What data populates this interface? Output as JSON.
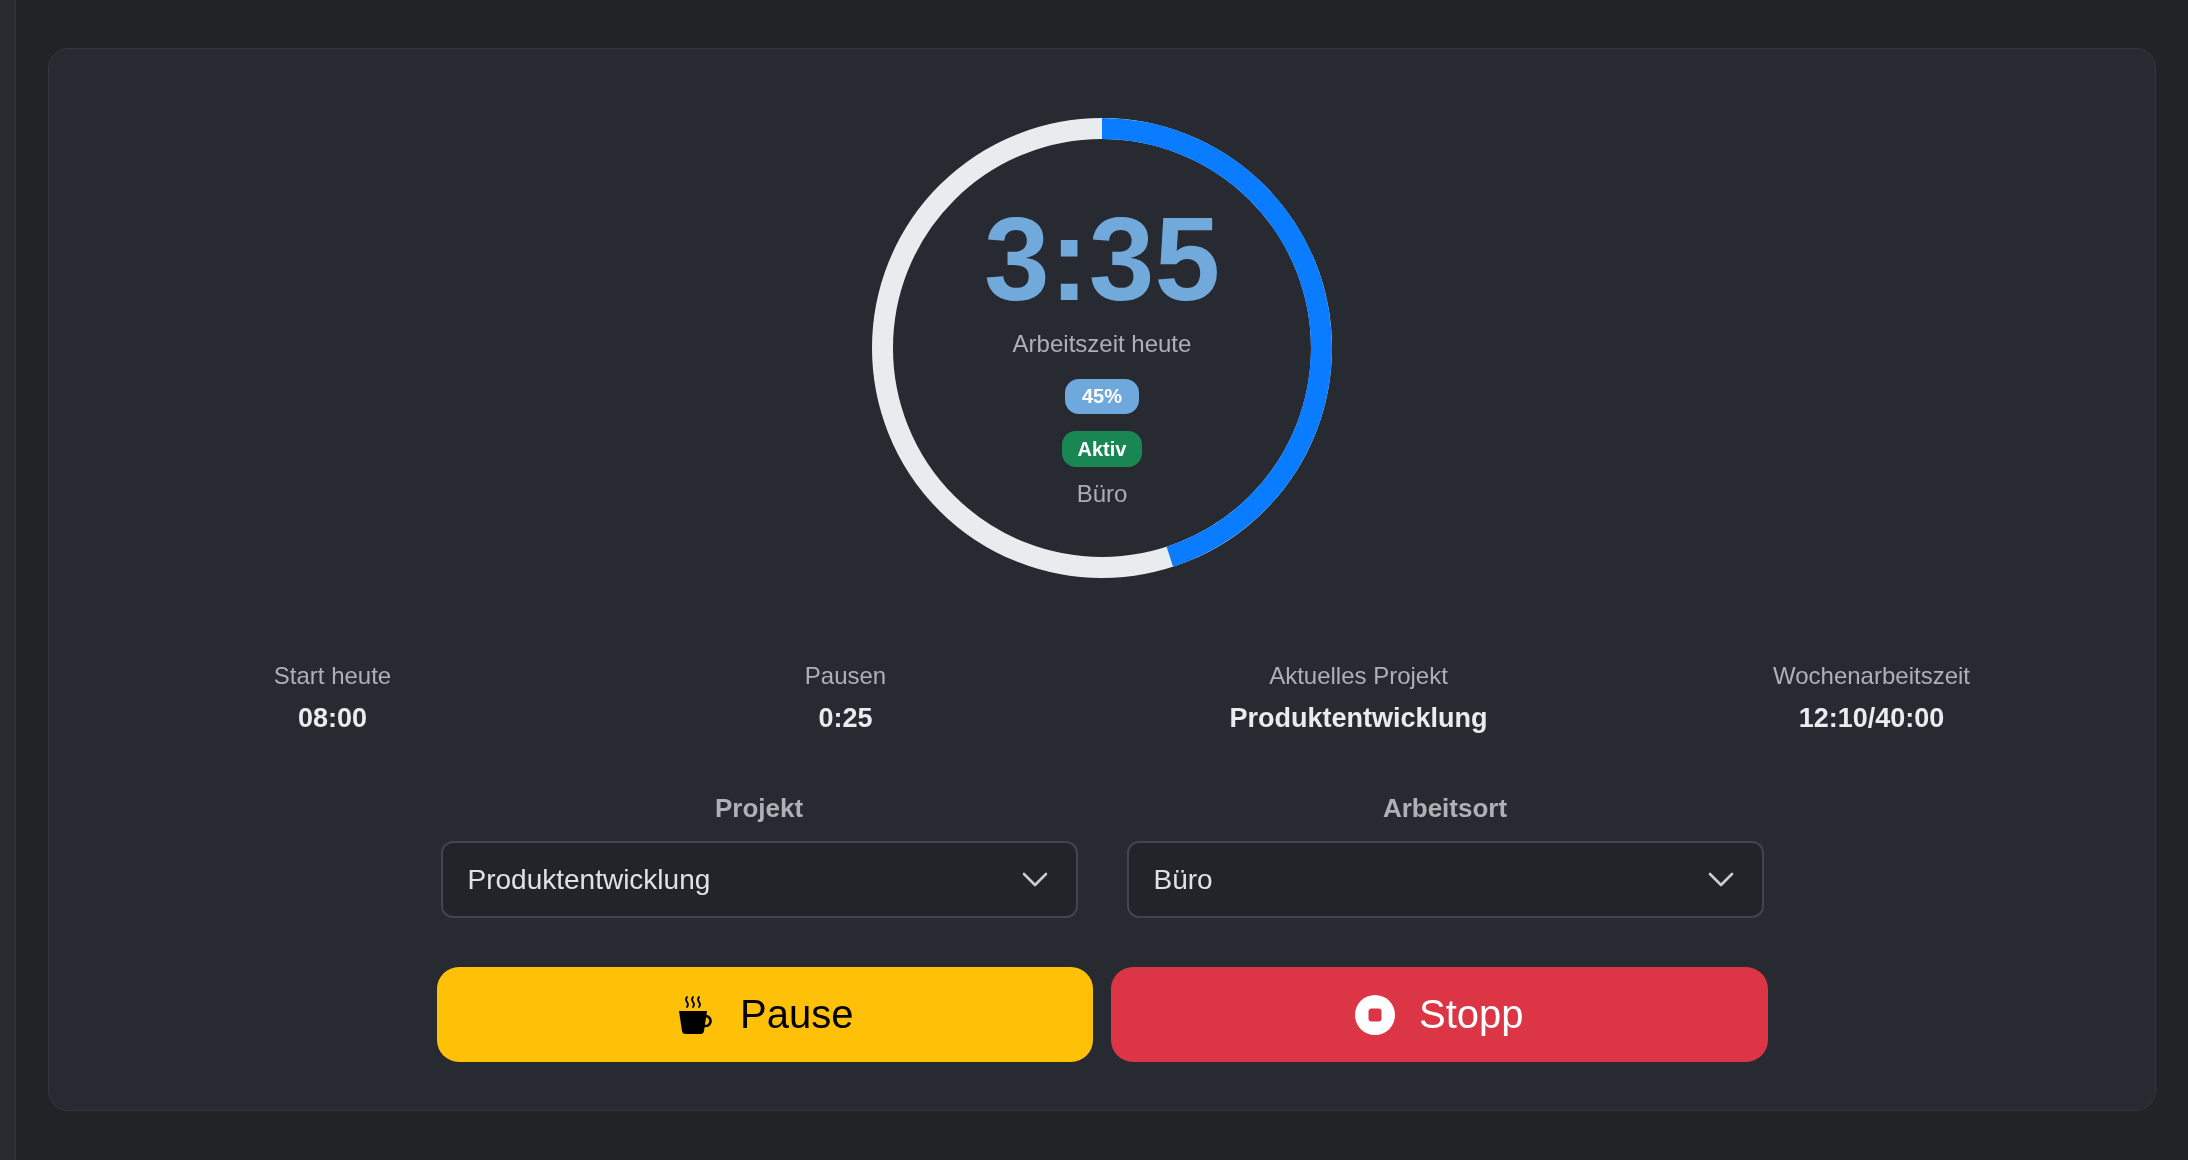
{
  "timer": {
    "time": "3:35",
    "caption": "Arbeitszeit heute",
    "level": 0.45,
    "percent": "45%",
    "status": "Aktiv",
    "location": "Büro"
  },
  "stats": [
    {
      "label": "Start heute",
      "value": "08:00"
    },
    {
      "label": "Pausen",
      "value": "0:25"
    },
    {
      "label": "Aktuelles Projekt",
      "value": "Produktentwicklung"
    },
    {
      "label": "Wochenarbeitszeit",
      "value": "12:10/40:00"
    }
  ],
  "selects": [
    {
      "label": "Projekt",
      "value": "Produktentwicklung"
    },
    {
      "label": "Arbeitsort",
      "value": "Büro"
    }
  ],
  "buttons": [
    {
      "label": "Pause",
      "kind": "pause"
    },
    {
      "label": "Stopp",
      "kind": "stop"
    }
  ]
}
